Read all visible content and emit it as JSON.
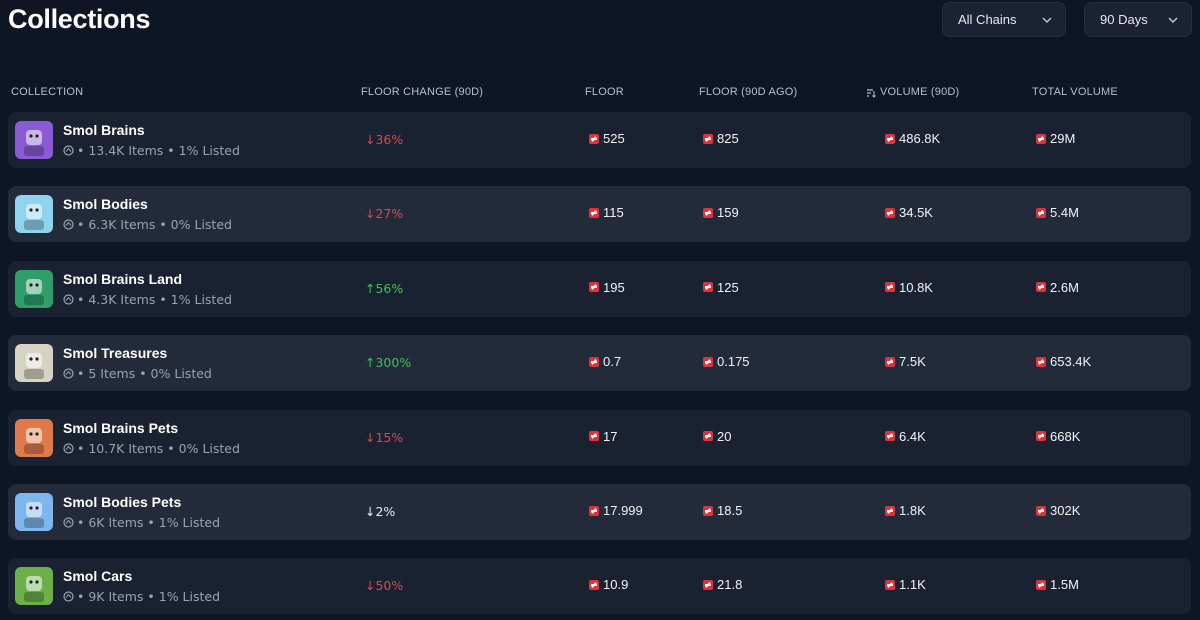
{
  "page": {
    "title": "Collections"
  },
  "filters": {
    "chains": "All Chains",
    "period": "90 Days"
  },
  "table": {
    "headers": {
      "collection": "COLLECTION",
      "floor_change": "FLOOR CHANGE (90D)",
      "floor": "FLOOR",
      "floor_ago": "FLOOR (90D AGO)",
      "volume": "VOLUME (90D)",
      "total_volume": "TOTAL VOLUME"
    },
    "rows": [
      {
        "name": "Smol Brains",
        "meta": "• 13.4K Items • 1% Listed",
        "change": "↓36%",
        "direction": "down",
        "floor": "525",
        "floor_ago": "825",
        "volume": "486.8K",
        "total": "29M",
        "thumb_color": "#8b5bd6"
      },
      {
        "name": "Smol Bodies",
        "meta": "• 6.3K Items • 0% Listed",
        "change": "↓27%",
        "direction": "down",
        "floor": "115",
        "floor_ago": "159",
        "volume": "34.5K",
        "total": "5.4M",
        "thumb_color": "#8fd3ee"
      },
      {
        "name": "Smol Brains Land",
        "meta": "• 4.3K Items • 1% Listed",
        "change": "↑56%",
        "direction": "up",
        "floor": "195",
        "floor_ago": "125",
        "volume": "10.8K",
        "total": "2.6M",
        "thumb_color": "#2f9e6a"
      },
      {
        "name": "Smol Treasures",
        "meta": "• 5 Items • 0% Listed",
        "change": "↑300%",
        "direction": "up",
        "floor": "0.7",
        "floor_ago": "0.175",
        "volume": "7.5K",
        "total": "653.4K",
        "thumb_color": "#d6d2c4"
      },
      {
        "name": "Smol Brains Pets",
        "meta": "• 10.7K Items • 0% Listed",
        "change": "↓15%",
        "direction": "down",
        "floor": "17",
        "floor_ago": "20",
        "volume": "6.4K",
        "total": "668K",
        "thumb_color": "#e07a4a"
      },
      {
        "name": "Smol Bodies Pets",
        "meta": "• 6K Items • 1% Listed",
        "change": "↓2%",
        "direction": "neutral",
        "floor": "17.999",
        "floor_ago": "18.5",
        "volume": "1.8K",
        "total": "302K",
        "thumb_color": "#7fb6ec"
      },
      {
        "name": "Smol Cars",
        "meta": "• 9K Items • 1% Listed",
        "change": "↓50%",
        "direction": "down",
        "floor": "10.9",
        "floor_ago": "21.8",
        "volume": "1.1K",
        "total": "1.5M",
        "thumb_color": "#6db04a"
      }
    ]
  },
  "colors": {
    "background": "#0e1524",
    "row": "#1a2232",
    "row_alt": "#232b3b",
    "down": "#e0464c",
    "up": "#3fbf5f",
    "magic": "#e3313c"
  },
  "icons": [
    "chevron-down-icon",
    "sort-icon",
    "chain-icon",
    "magic-token-icon"
  ]
}
